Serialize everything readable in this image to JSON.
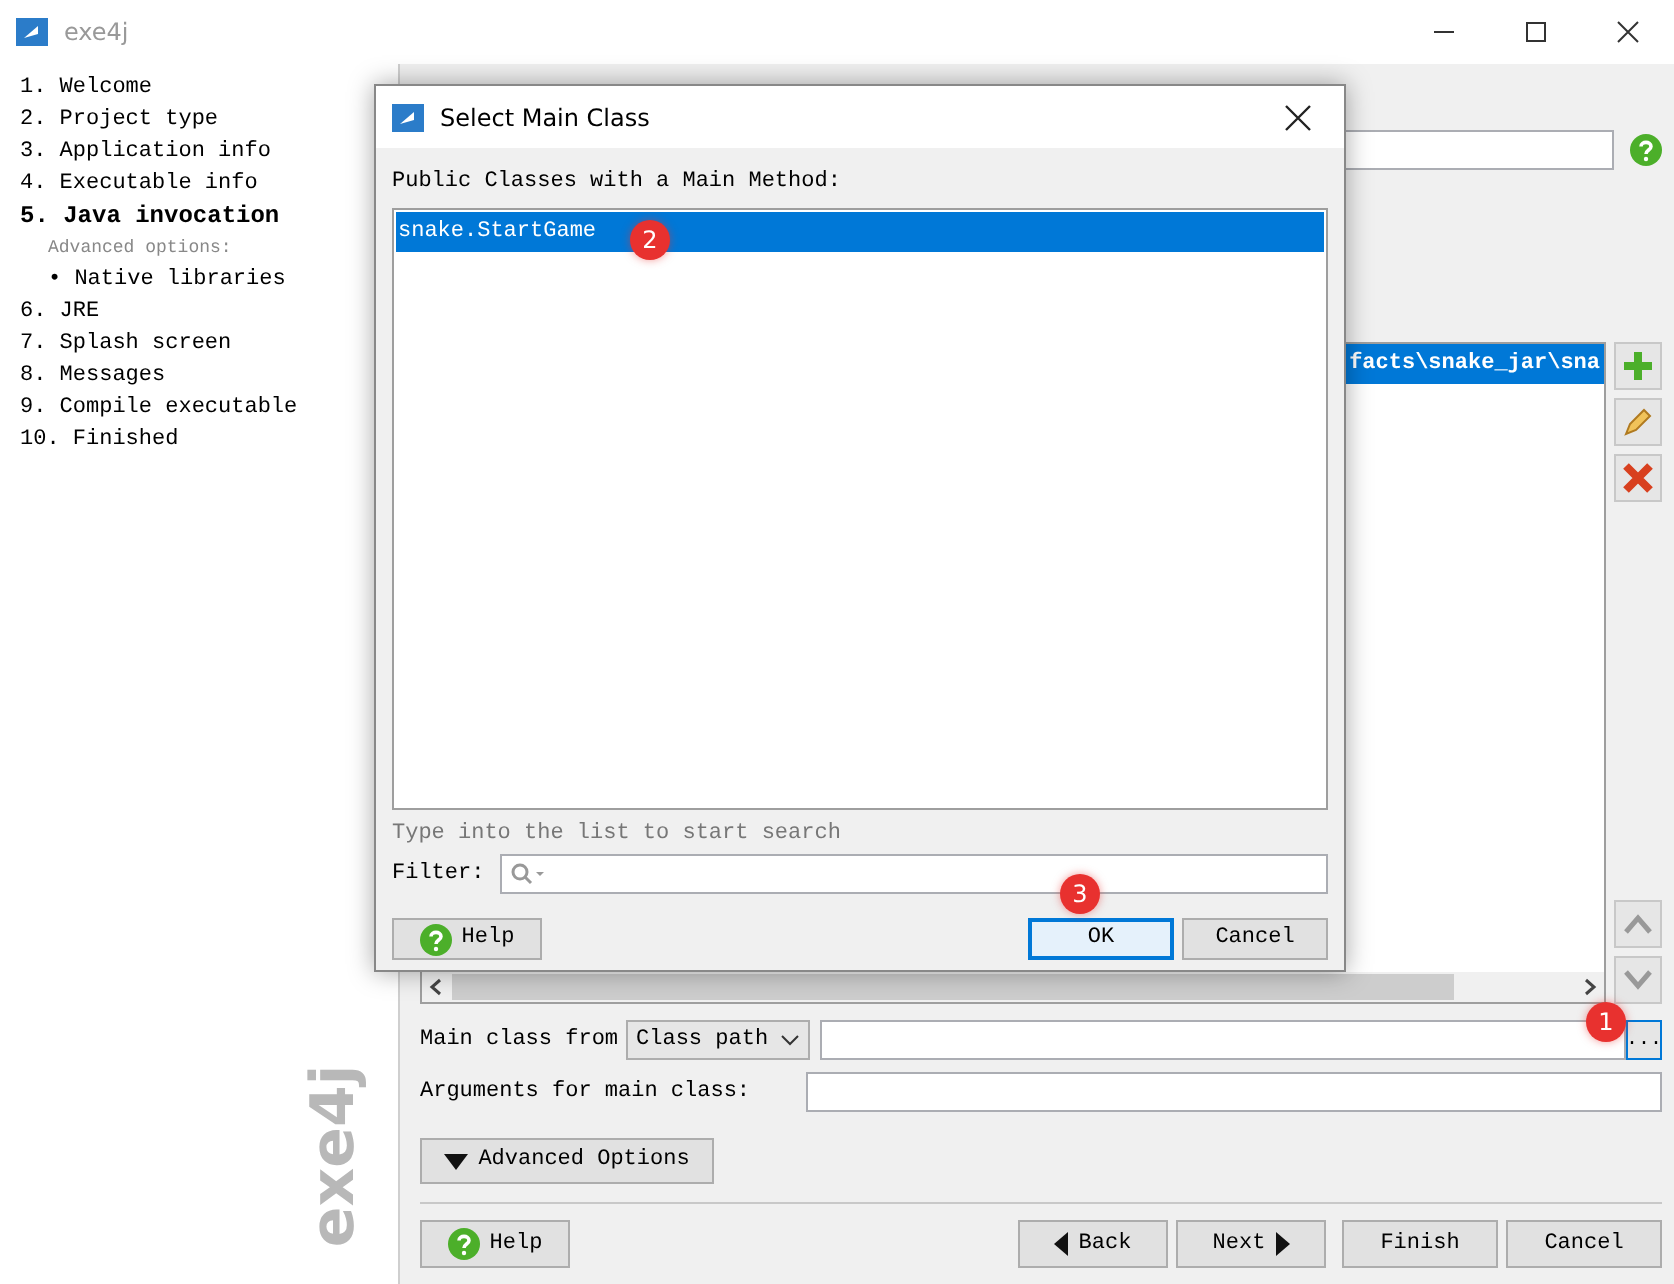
{
  "window": {
    "title": "exe4j"
  },
  "steps": [
    {
      "label": "1. Welcome",
      "kind": "step",
      "selected": false
    },
    {
      "label": "2. Project type",
      "kind": "step",
      "selected": false
    },
    {
      "label": "3. Application info",
      "kind": "step",
      "selected": false
    },
    {
      "label": "4. Executable info",
      "kind": "step",
      "selected": false
    },
    {
      "label": "5. Java invocation",
      "kind": "step",
      "selected": true
    },
    {
      "label": "Advanced options:",
      "kind": "heading",
      "selected": false
    },
    {
      "label": "• Native libraries",
      "kind": "sub",
      "selected": false
    },
    {
      "label": "6. JRE",
      "kind": "step",
      "selected": false
    },
    {
      "label": "7. Splash screen",
      "kind": "step",
      "selected": false
    },
    {
      "label": "8. Messages",
      "kind": "step",
      "selected": false
    },
    {
      "label": "9. Compile executable",
      "kind": "step",
      "selected": false
    },
    {
      "label": "10. Finished",
      "kind": "step",
      "selected": false
    }
  ],
  "logo_text": "exe4j",
  "classpath": {
    "rows": [
      {
        "text": "facts\\snake_jar\\sna",
        "selected": true
      }
    ]
  },
  "main_class": {
    "label": "Main class from",
    "source": "Class path",
    "browse_label": "...",
    "marker": "1"
  },
  "arguments": {
    "label": "Arguments for main class:"
  },
  "advanced_button": "Advanced Options",
  "footer_buttons": [
    {
      "label": "Help",
      "kind": "help"
    },
    {
      "label": "Back",
      "kind": "back"
    },
    {
      "label": "Next",
      "kind": "next"
    },
    {
      "label": "Finish",
      "kind": "plain"
    },
    {
      "label": "Cancel",
      "kind": "plain"
    }
  ],
  "dialog": {
    "title": "Select Main Class",
    "list_label": "Public Classes with a Main Method:",
    "classes": [
      {
        "name": "snake.StartGame",
        "selected": true,
        "marker": "2"
      }
    ],
    "hint": "Type into the list to start search",
    "filter_label": "Filter:",
    "buttons": [
      {
        "label": "Help",
        "kind": "help"
      },
      {
        "label": "OK",
        "kind": "default",
        "marker": "3"
      },
      {
        "label": "Cancel",
        "kind": "plain"
      }
    ]
  }
}
